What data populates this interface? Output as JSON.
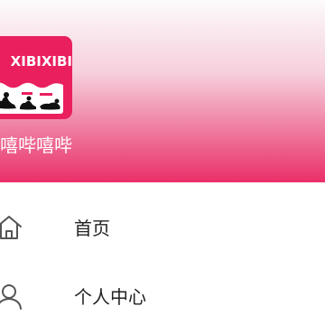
{
  "header": {
    "logo_text": "XIBIXIBI",
    "app_name": "嘻哔嘻哔"
  },
  "menu": {
    "items": [
      {
        "label": "首页",
        "icon": "home-icon"
      },
      {
        "label": "个人中心",
        "icon": "user-icon"
      }
    ]
  },
  "colors": {
    "brand_pink": "#ea1f5e",
    "header_gradient_start": "#fcfbfc",
    "header_gradient_end": "#ea2f69",
    "menu_text": "#222222",
    "icon_stroke": "#555555"
  }
}
